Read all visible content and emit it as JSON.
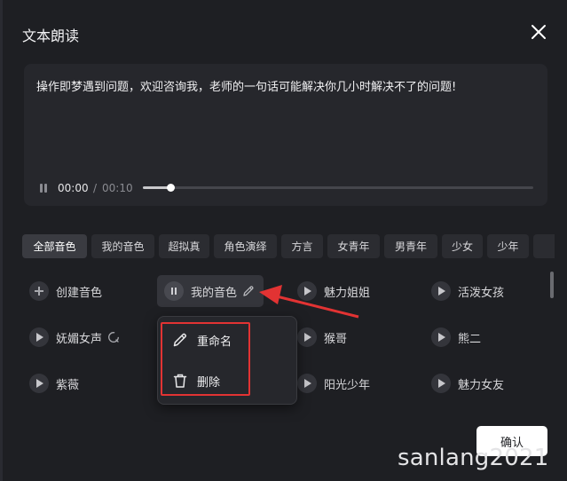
{
  "dialog": {
    "title": "文本朗读"
  },
  "text_panel": {
    "content": "操作即梦遇到问题，欢迎咨询我，老师的一句话可能解决你几小时解决不了的问题!",
    "player": {
      "current_time": "00:00",
      "separator": "/",
      "total_time": "00:10",
      "progress": 0.07
    }
  },
  "tabs": [
    {
      "label": "全部音色",
      "active": true
    },
    {
      "label": "我的音色",
      "active": false
    },
    {
      "label": "超拟真",
      "active": false
    },
    {
      "label": "角色演绎",
      "active": false
    },
    {
      "label": "方言",
      "active": false
    },
    {
      "label": "女青年",
      "active": false
    },
    {
      "label": "男青年",
      "active": false
    },
    {
      "label": "少女",
      "active": false
    },
    {
      "label": "少年",
      "active": false
    }
  ],
  "voices": {
    "create": "创建音色",
    "my_voice": "我的音色",
    "meili_jiejie": "魅力姐姐",
    "huopo_nvhai": "活泼女孩",
    "wumei_nvsheng": "妩媚女声",
    "houge": "猴哥",
    "xiaoer": "熊二",
    "ziwei": "紫薇",
    "yangguang_shaonian": "阳光少年",
    "meili_nvyou": "魅力女友"
  },
  "context_menu": {
    "rename": "重命名",
    "delete": "删除"
  },
  "footer": {
    "confirm": "确认"
  },
  "watermark": "sanlang2021",
  "colors": {
    "background": "#1e1f23",
    "panel": "#26272c",
    "highlight_red": "#e23333"
  },
  "icons": [
    "close-icon",
    "pause-icon",
    "play-icon",
    "plus-icon",
    "pencil-icon",
    "trash-icon",
    "voice-clone-icon"
  ]
}
